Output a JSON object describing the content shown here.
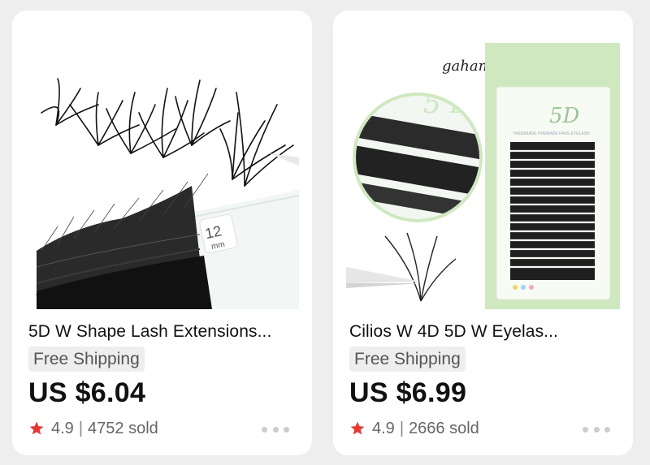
{
  "products": [
    {
      "title": "5D W Shape Lash Extensions...",
      "shipping": "Free Shipping",
      "price": "US $6.04",
      "rating": "4.9",
      "sold": "4752 sold",
      "image_label": "12mm"
    },
    {
      "title": "Cilios W 4D 5D W Eyelas...",
      "shipping": "Free Shipping",
      "price": "US $6.99",
      "rating": "4.9",
      "sold": "2666 sold",
      "brand": "gahamaca",
      "image_label": "5D"
    }
  ],
  "colors": {
    "background": "#eeeeee",
    "card": "#ffffff",
    "star": "#e53935",
    "shipping_badge": "#eeeeee",
    "packaging_green": "#cfe8c0"
  }
}
